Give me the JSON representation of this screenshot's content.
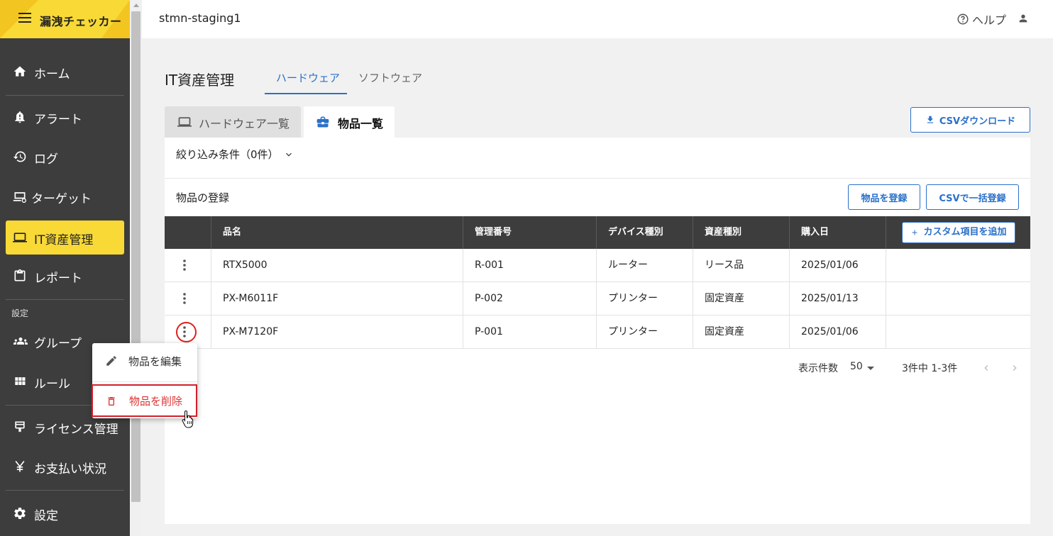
{
  "sidebar": {
    "brand": "漏洩チェッカー",
    "items": [
      {
        "label": "ホーム",
        "icon": "home-icon"
      },
      {
        "label": "アラート",
        "icon": "alert-bell-icon"
      },
      {
        "label": "ログ",
        "icon": "history-icon"
      },
      {
        "label": "ターゲット",
        "icon": "target-laptop-icon"
      },
      {
        "label": "IT資産管理",
        "icon": "laptop-icon",
        "active": true
      },
      {
        "label": "レポート",
        "icon": "clipboard-icon"
      }
    ],
    "settings_section": "設定",
    "settings_items": [
      {
        "label": "グループ",
        "icon": "group-icon"
      },
      {
        "label": "ルール",
        "icon": "grid-icon"
      }
    ],
    "bottom_items": [
      {
        "label": "ライセンス管理",
        "icon": "license-icon"
      },
      {
        "label": "お支払い状況",
        "icon": "yen-icon"
      }
    ],
    "footer_item": {
      "label": "設定",
      "icon": "gear-icon"
    }
  },
  "header": {
    "project": "stmn-staging1",
    "help": "ヘルプ"
  },
  "page": {
    "title": "IT資産管理",
    "tabs": [
      "ハードウェア",
      "ソフトウェア"
    ],
    "subtabs": [
      "ハードウェア一覧",
      "物品一覧"
    ],
    "csv_download": "CSVダウンロード",
    "filter": "絞り込み条件（0件）",
    "register_label": "物品の登録",
    "register_button": "物品を登録",
    "bulk_button": "CSVで一括登録"
  },
  "table": {
    "headers": [
      "品名",
      "管理番号",
      "デバイス種別",
      "資産種別",
      "購入日"
    ],
    "add_custom": "カスタム項目を追加",
    "rows": [
      [
        "RTX5000",
        "R-001",
        "ルーター",
        "リース品",
        "2025/01/06"
      ],
      [
        "PX-M6011F",
        "P-002",
        "プリンター",
        "固定資産",
        "2025/01/13"
      ],
      [
        "PX-M7120F",
        "P-001",
        "プリンター",
        "固定資産",
        "2025/01/06"
      ]
    ]
  },
  "pagination": {
    "per_page_label": "表示件数",
    "per_page": "50",
    "range": "3件中 1-3件"
  },
  "context_menu": {
    "edit": "物品を編集",
    "delete": "物品を削除"
  },
  "colors": {
    "sidebar": "#3d3d3d",
    "accent_yellow": "#f8d936",
    "primary_blue": "#2a70c9",
    "danger": "#d33333"
  }
}
